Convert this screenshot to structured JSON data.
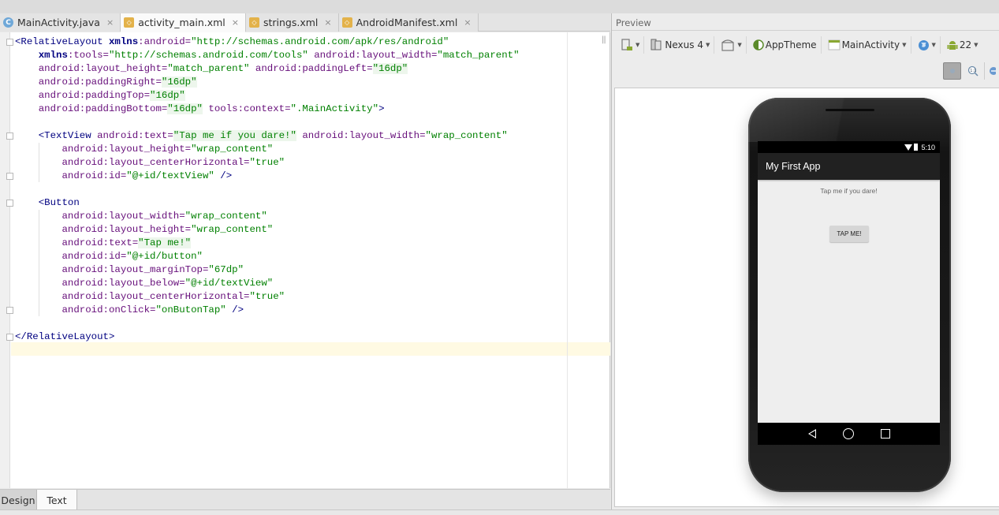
{
  "editor_tabs": [
    {
      "label": "MainActivity.java",
      "icon": "java-class-icon",
      "active": false
    },
    {
      "label": "activity_main.xml",
      "icon": "xml-file-icon",
      "active": true
    },
    {
      "label": "strings.xml",
      "icon": "xml-file-icon",
      "active": false
    },
    {
      "label": "AndroidManifest.xml",
      "icon": "xml-file-icon",
      "active": false
    }
  ],
  "close_glyph": "×",
  "code_lines": [
    [
      {
        "t": "tag",
        "s": "<RelativeLayout "
      },
      {
        "t": "ns",
        "s": "xmlns"
      },
      {
        "t": "attr",
        "s": ":android="
      },
      {
        "t": "val",
        "s": "\"http://schemas.android.com/apk/res/android\""
      }
    ],
    [
      {
        "t": "p",
        "s": "    "
      },
      {
        "t": "ns",
        "s": "xmlns"
      },
      {
        "t": "attr",
        "s": ":tools="
      },
      {
        "t": "val",
        "s": "\"http://schemas.android.com/tools\""
      },
      {
        "t": "p",
        "s": " "
      },
      {
        "t": "attr",
        "s": "android:layout_width="
      },
      {
        "t": "val",
        "s": "\"match_parent\""
      }
    ],
    [
      {
        "t": "p",
        "s": "    "
      },
      {
        "t": "attr",
        "s": "android:layout_height="
      },
      {
        "t": "val",
        "s": "\"match_parent\""
      },
      {
        "t": "p",
        "s": " "
      },
      {
        "t": "attr",
        "s": "android:paddingLeft="
      },
      {
        "t": "valhl",
        "s": "\"16dp\""
      }
    ],
    [
      {
        "t": "p",
        "s": "    "
      },
      {
        "t": "attr",
        "s": "android:paddingRight="
      },
      {
        "t": "valhl",
        "s": "\"16dp\""
      }
    ],
    [
      {
        "t": "p",
        "s": "    "
      },
      {
        "t": "attr",
        "s": "android:paddingTop="
      },
      {
        "t": "valhl",
        "s": "\"16dp\""
      }
    ],
    [
      {
        "t": "p",
        "s": "    "
      },
      {
        "t": "attr",
        "s": "android:paddingBottom="
      },
      {
        "t": "valhl",
        "s": "\"16dp\""
      },
      {
        "t": "p",
        "s": " "
      },
      {
        "t": "attr",
        "s": "tools:context="
      },
      {
        "t": "val",
        "s": "\".MainActivity\""
      },
      {
        "t": "tag",
        "s": ">"
      }
    ],
    [],
    [
      {
        "t": "p",
        "s": "    "
      },
      {
        "t": "tag",
        "s": "<TextView "
      },
      {
        "t": "attr",
        "s": "android:text="
      },
      {
        "t": "valhl",
        "s": "\"Tap me if you dare!\""
      },
      {
        "t": "p",
        "s": " "
      },
      {
        "t": "attr",
        "s": "android:layout_width="
      },
      {
        "t": "val",
        "s": "\"wrap_content\""
      }
    ],
    [
      {
        "t": "p",
        "s": "        "
      },
      {
        "t": "attr",
        "s": "android:layout_height="
      },
      {
        "t": "val",
        "s": "\"wrap_content\""
      }
    ],
    [
      {
        "t": "p",
        "s": "        "
      },
      {
        "t": "attr",
        "s": "android:layout_centerHorizontal="
      },
      {
        "t": "val",
        "s": "\"true\""
      }
    ],
    [
      {
        "t": "p",
        "s": "        "
      },
      {
        "t": "attr",
        "s": "android:id="
      },
      {
        "t": "val",
        "s": "\"@+id/textView\""
      },
      {
        "t": "tag",
        "s": " />"
      }
    ],
    [],
    [
      {
        "t": "p",
        "s": "    "
      },
      {
        "t": "tag",
        "s": "<Button"
      }
    ],
    [
      {
        "t": "p",
        "s": "        "
      },
      {
        "t": "attr",
        "s": "android:layout_width="
      },
      {
        "t": "val",
        "s": "\"wrap_content\""
      }
    ],
    [
      {
        "t": "p",
        "s": "        "
      },
      {
        "t": "attr",
        "s": "android:layout_height="
      },
      {
        "t": "val",
        "s": "\"wrap_content\""
      }
    ],
    [
      {
        "t": "p",
        "s": "        "
      },
      {
        "t": "attr",
        "s": "android:text="
      },
      {
        "t": "valhl",
        "s": "\"Tap me!\""
      }
    ],
    [
      {
        "t": "p",
        "s": "        "
      },
      {
        "t": "attr",
        "s": "android:id="
      },
      {
        "t": "val",
        "s": "\"@+id/button\""
      }
    ],
    [
      {
        "t": "p",
        "s": "        "
      },
      {
        "t": "attr",
        "s": "android:layout_marginTop="
      },
      {
        "t": "val",
        "s": "\"67dp\""
      }
    ],
    [
      {
        "t": "p",
        "s": "        "
      },
      {
        "t": "attr",
        "s": "android:layout_below="
      },
      {
        "t": "val",
        "s": "\"@+id/textView\""
      }
    ],
    [
      {
        "t": "p",
        "s": "        "
      },
      {
        "t": "attr",
        "s": "android:layout_centerHorizontal="
      },
      {
        "t": "val",
        "s": "\"true\""
      }
    ],
    [
      {
        "t": "p",
        "s": "        "
      },
      {
        "t": "attr",
        "s": "android:onClick="
      },
      {
        "t": "val",
        "s": "\"onButonTap\""
      },
      {
        "t": "tag",
        "s": " />"
      }
    ],
    [],
    [
      {
        "t": "tag",
        "s": "</RelativeLayout>"
      }
    ],
    []
  ],
  "bottom_tabs": {
    "design": "Design",
    "text": "Text",
    "active": "Text"
  },
  "preview": {
    "title": "Preview",
    "toolbar": {
      "device": "Nexus 4",
      "theme": "AppTheme",
      "activity": "MainActivity",
      "api_level": "22"
    },
    "phone": {
      "time": "5:10",
      "app_title": "My First App",
      "text_view": "Tap me if you dare!",
      "button_label": "TAP ME!"
    }
  }
}
